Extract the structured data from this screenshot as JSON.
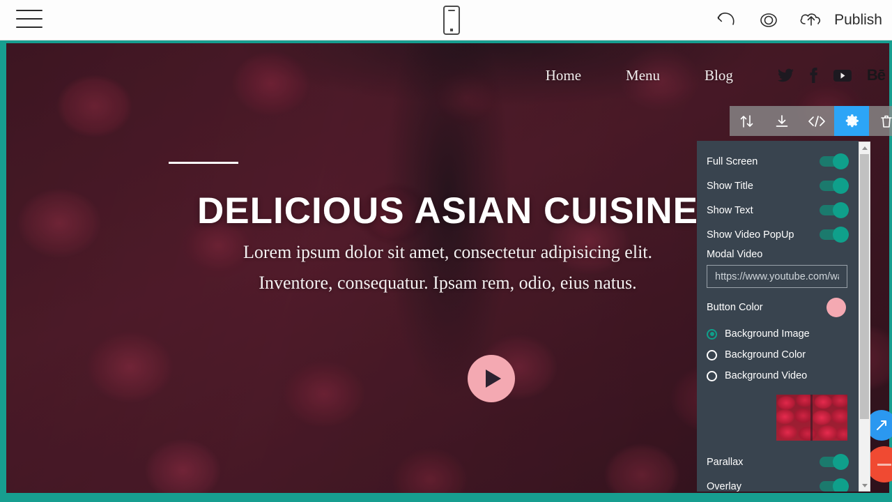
{
  "topbar": {
    "menu_icon": "hamburger-icon",
    "device_icon": "mobile-phone-icon",
    "undo_icon": "undo-arrow-icon",
    "preview_icon": "eye-preview-icon",
    "publish_icon": "cloud-upload-icon",
    "publish_label": "Publish"
  },
  "site_nav": {
    "links": [
      {
        "label": "Home"
      },
      {
        "label": "Menu"
      },
      {
        "label": "Blog"
      }
    ],
    "social": [
      {
        "name": "twitter-icon"
      },
      {
        "name": "facebook-icon"
      },
      {
        "name": "youtube-icon"
      },
      {
        "name": "behance-icon",
        "label": "Bē"
      }
    ]
  },
  "hero": {
    "title": "DELICIOUS ASIAN CUISINE",
    "subtitle_line1": "Lorem ipsum dolor sit amet, consectetur adipisicing elit.",
    "subtitle_line2": "Inventore, consequatur. Ipsam rem, odio, eius natus.",
    "play_button": "play-video-button",
    "play_button_color": "#f4a9b2"
  },
  "block_toolbar": {
    "items": [
      {
        "name": "move-block-icon",
        "active": false
      },
      {
        "name": "download-block-icon",
        "active": false
      },
      {
        "name": "edit-code-icon",
        "active": false
      },
      {
        "name": "block-settings-gear-icon",
        "active": true
      },
      {
        "name": "delete-block-icon",
        "active": false
      }
    ],
    "active_color": "#2ca5f7"
  },
  "settings_panel": {
    "background_color": "#39444f",
    "toggle_color": "#0fa08b",
    "toggles": [
      {
        "label": "Full Screen",
        "on": true
      },
      {
        "label": "Show Title",
        "on": true
      },
      {
        "label": "Show Text",
        "on": true
      },
      {
        "label": "Show Video PopUp",
        "on": true
      }
    ],
    "modal_video": {
      "label": "Modal Video",
      "value": "",
      "placeholder": "https://www.youtube.com/watch?v="
    },
    "button_color": {
      "label": "Button Color",
      "value": "#f4a9b2"
    },
    "background_options": [
      {
        "label": "Background Image",
        "selected": true
      },
      {
        "label": "Background Color",
        "selected": false
      },
      {
        "label": "Background Video",
        "selected": false
      }
    ],
    "background_thumbnail": "strawberries-thumbnail",
    "bottom_toggles": [
      {
        "label": "Parallax",
        "on": true
      },
      {
        "label": "Overlay",
        "on": true
      }
    ]
  },
  "floating_buttons": [
    {
      "name": "cursor-action-button",
      "color": "#2b98f0"
    },
    {
      "name": "remove-action-button",
      "color": "#f04a32"
    }
  ]
}
